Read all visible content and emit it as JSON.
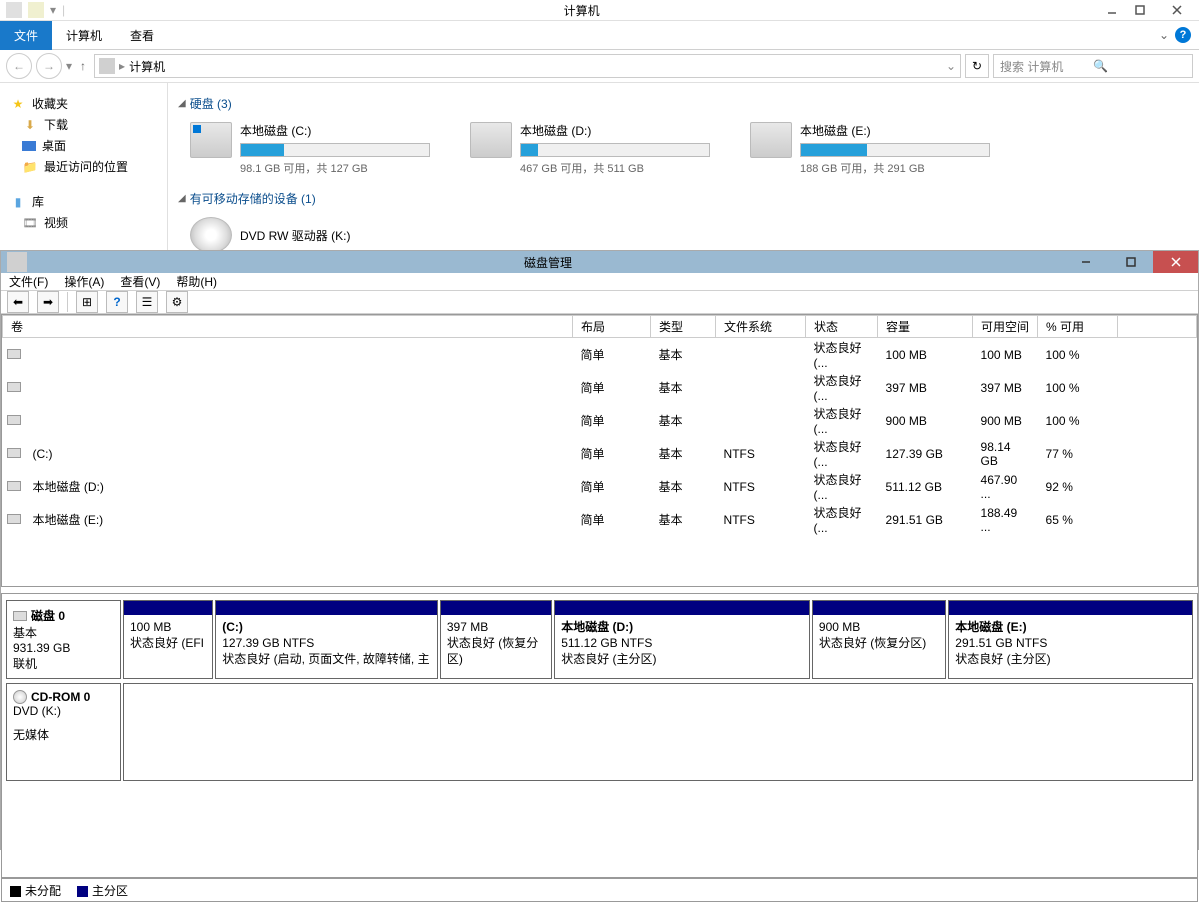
{
  "explorer": {
    "title": "计算机",
    "ribbon_tabs": {
      "file": "文件",
      "computer": "计算机",
      "view": "查看"
    },
    "address": "计算机",
    "search_placeholder": "搜索 计算机",
    "sidebar": {
      "favorites": {
        "title": "收藏夹",
        "downloads": "下载",
        "desktop": "桌面",
        "recent": "最近访问的位置"
      },
      "libraries": {
        "title": "库",
        "videos": "视频"
      }
    },
    "sections": {
      "hdd": {
        "title": "硬盘 (3)"
      },
      "removable": {
        "title": "有可移动存储的设备 (1)"
      }
    },
    "drives": {
      "c": {
        "name": "本地磁盘 (C:)",
        "text": "98.1 GB 可用，共 127 GB",
        "pct": 23
      },
      "d": {
        "name": "本地磁盘 (D:)",
        "text": "467 GB 可用，共 511 GB",
        "pct": 9
      },
      "e": {
        "name": "本地磁盘 (E:)",
        "text": "188 GB 可用，共 291 GB",
        "pct": 35
      },
      "dvd": {
        "name": "DVD RW 驱动器 (K:)"
      }
    }
  },
  "diskmgmt": {
    "title": "磁盘管理",
    "menu": {
      "file": "文件(F)",
      "action": "操作(A)",
      "view": "查看(V)",
      "help": "帮助(H)"
    },
    "cols": {
      "volume": "卷",
      "layout": "布局",
      "type": "类型",
      "fs": "文件系统",
      "status": "状态",
      "capacity": "容量",
      "free": "可用空间",
      "pct": "% 可用"
    },
    "rows": [
      {
        "vol": "",
        "layout": "简单",
        "type": "基本",
        "fs": "",
        "status": "状态良好 (...",
        "cap": "100 MB",
        "free": "100 MB",
        "pct": "100 %"
      },
      {
        "vol": "",
        "layout": "简单",
        "type": "基本",
        "fs": "",
        "status": "状态良好 (...",
        "cap": "397 MB",
        "free": "397 MB",
        "pct": "100 %"
      },
      {
        "vol": "",
        "layout": "简单",
        "type": "基本",
        "fs": "",
        "status": "状态良好 (...",
        "cap": "900 MB",
        "free": "900 MB",
        "pct": "100 %"
      },
      {
        "vol": "(C:)",
        "layout": "简单",
        "type": "基本",
        "fs": "NTFS",
        "status": "状态良好 (...",
        "cap": "127.39 GB",
        "free": "98.14 GB",
        "pct": "77 %"
      },
      {
        "vol": "本地磁盘 (D:)",
        "layout": "简单",
        "type": "基本",
        "fs": "NTFS",
        "status": "状态良好 (...",
        "cap": "511.12 GB",
        "free": "467.90 ...",
        "pct": "92 %"
      },
      {
        "vol": "本地磁盘 (E:)",
        "layout": "简单",
        "type": "基本",
        "fs": "NTFS",
        "status": "状态良好 (...",
        "cap": "291.51 GB",
        "free": "188.49 ...",
        "pct": "65 %"
      }
    ],
    "disk0": {
      "label": "磁盘 0",
      "type": "基本",
      "size": "931.39 GB",
      "status": "联机",
      "parts": [
        {
          "w": 8,
          "l1": "100 MB",
          "l2": "状态良好 (EFI"
        },
        {
          "w": 20,
          "t": "(C:)",
          "l1": "127.39 GB NTFS",
          "l2": "状态良好 (启动, 页面文件, 故障转储, 主"
        },
        {
          "w": 10,
          "l1": "397 MB",
          "l2": "状态良好 (恢复分区)"
        },
        {
          "w": 23,
          "t": "本地磁盘   (D:)",
          "l1": "511.12 GB NTFS",
          "l2": "状态良好 (主分区)"
        },
        {
          "w": 12,
          "l1": "900 MB",
          "l2": "状态良好 (恢复分区)"
        },
        {
          "w": 22,
          "t": "本地磁盘   (E:)",
          "l1": "291.51 GB NTFS",
          "l2": "状态良好 (主分区)"
        }
      ]
    },
    "cdrom": {
      "label": "CD-ROM 0",
      "drive": "DVD (K:)",
      "status": "无媒体"
    },
    "legend": {
      "unalloc": "未分配",
      "primary": "主分区"
    }
  }
}
